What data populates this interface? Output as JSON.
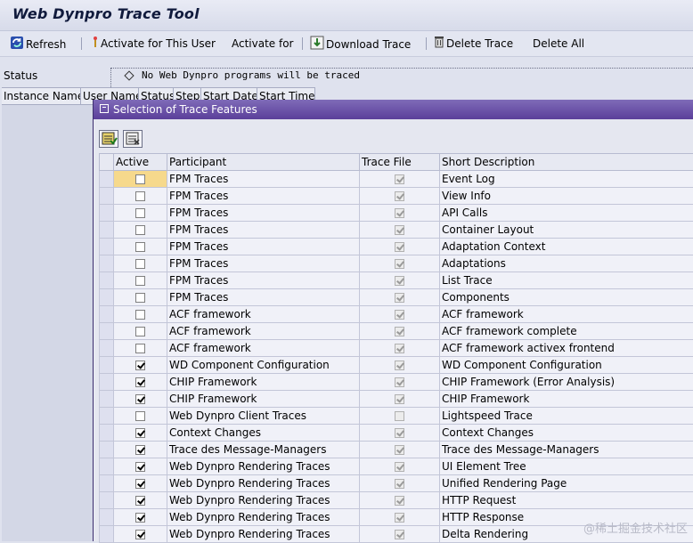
{
  "window": {
    "title": "Web Dynpro Trace Tool"
  },
  "toolbar": {
    "refresh": "Refresh",
    "activate_user": "Activate for This User",
    "activate_for": "Activate for",
    "download": "Download Trace",
    "delete": "Delete Trace",
    "delete_all": "Delete All"
  },
  "status": {
    "label": "Status",
    "message": "No Web Dynpro programs will be traced"
  },
  "bg_table": {
    "columns": [
      "Instance Name",
      "User Name",
      "Status",
      "Step",
      "Start Date",
      "Start Time"
    ]
  },
  "dialog": {
    "title": "Selection of Trace Features",
    "columns": {
      "active": "Active",
      "participant": "Participant",
      "trace_file": "Trace File",
      "short_description": "Short Description"
    },
    "rows": [
      {
        "active": false,
        "participant": "FPM Traces",
        "trace_file": true,
        "description": "Event Log"
      },
      {
        "active": false,
        "participant": "FPM Traces",
        "trace_file": true,
        "description": "View Info"
      },
      {
        "active": false,
        "participant": "FPM Traces",
        "trace_file": true,
        "description": "API Calls"
      },
      {
        "active": false,
        "participant": "FPM Traces",
        "trace_file": true,
        "description": "Container Layout"
      },
      {
        "active": false,
        "participant": "FPM Traces",
        "trace_file": true,
        "description": "Adaptation Context"
      },
      {
        "active": false,
        "participant": "FPM Traces",
        "trace_file": true,
        "description": "Adaptations"
      },
      {
        "active": false,
        "participant": "FPM Traces",
        "trace_file": true,
        "description": "List Trace"
      },
      {
        "active": false,
        "participant": "FPM Traces",
        "trace_file": true,
        "description": "Components"
      },
      {
        "active": false,
        "participant": "ACF framework",
        "trace_file": true,
        "description": "ACF framework"
      },
      {
        "active": false,
        "participant": "ACF framework",
        "trace_file": true,
        "description": "ACF framework complete"
      },
      {
        "active": false,
        "participant": "ACF framework",
        "trace_file": true,
        "description": "ACF framework activex frontend"
      },
      {
        "active": true,
        "participant": "WD Component Configuration",
        "trace_file": true,
        "description": "WD Component Configuration"
      },
      {
        "active": true,
        "participant": "CHIP Framework",
        "trace_file": true,
        "description": "CHIP Framework (Error Analysis)"
      },
      {
        "active": true,
        "participant": "CHIP Framework",
        "trace_file": true,
        "description": "CHIP Framework"
      },
      {
        "active": false,
        "participant": "Web Dynpro Client Traces",
        "trace_file": false,
        "description": "Lightspeed Trace"
      },
      {
        "active": true,
        "participant": "Context Changes",
        "trace_file": true,
        "description": "Context Changes"
      },
      {
        "active": true,
        "participant": "Trace des Message-Managers",
        "trace_file": true,
        "description": "Trace des Message-Managers"
      },
      {
        "active": true,
        "participant": "Web Dynpro Rendering Traces",
        "trace_file": true,
        "description": "UI Element Tree"
      },
      {
        "active": true,
        "participant": "Web Dynpro Rendering Traces",
        "trace_file": true,
        "description": "Unified Rendering Page"
      },
      {
        "active": true,
        "participant": "Web Dynpro Rendering Traces",
        "trace_file": true,
        "description": "HTTP Request"
      },
      {
        "active": true,
        "participant": "Web Dynpro Rendering Traces",
        "trace_file": true,
        "description": "HTTP Response"
      },
      {
        "active": true,
        "participant": "Web Dynpro Rendering Traces",
        "trace_file": true,
        "description": "Delta Rendering"
      }
    ]
  },
  "watermark": "@稀土掘金技术社区"
}
